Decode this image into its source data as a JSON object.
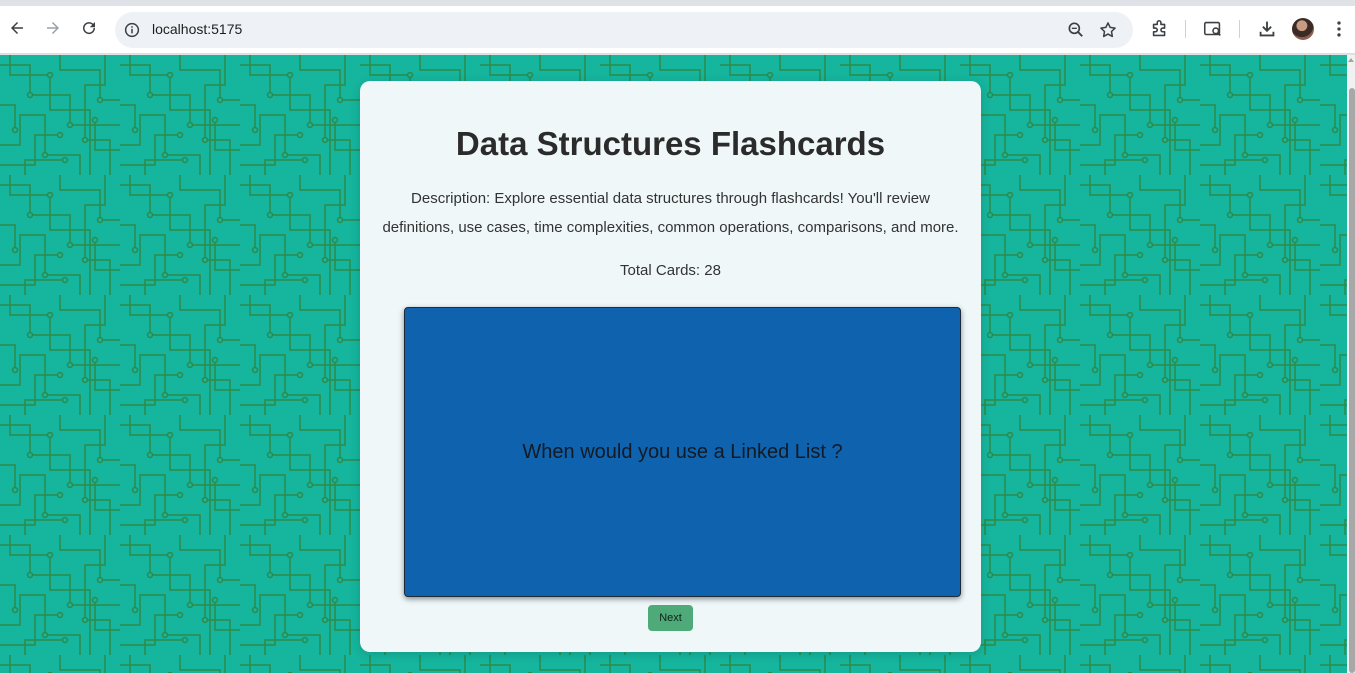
{
  "browser": {
    "url": "localhost:5175",
    "icons": [
      "back-icon",
      "forward-icon",
      "reload-icon",
      "site-info-icon",
      "zoom-icon",
      "bookmark-star-icon",
      "extensions-icon",
      "tab-search-icon",
      "download-icon",
      "profile-avatar",
      "menu-icon"
    ]
  },
  "app": {
    "title": "Data Structures Flashcards",
    "description": "Description: Explore essential data structures through flashcards! You'll review definitions, use cases, time complexities, common operations, comparisons, and more.",
    "total_label": "Total Cards:",
    "total_count": "28",
    "card_question": "When would you use a Linked List ?",
    "next_label": "Next"
  },
  "colors": {
    "background": "#16b59d",
    "circuit_lines": "#2e8a4a",
    "card_panel": "#eff7f9",
    "flashcard": "#0f63ae",
    "next_button": "#4eaa78"
  }
}
